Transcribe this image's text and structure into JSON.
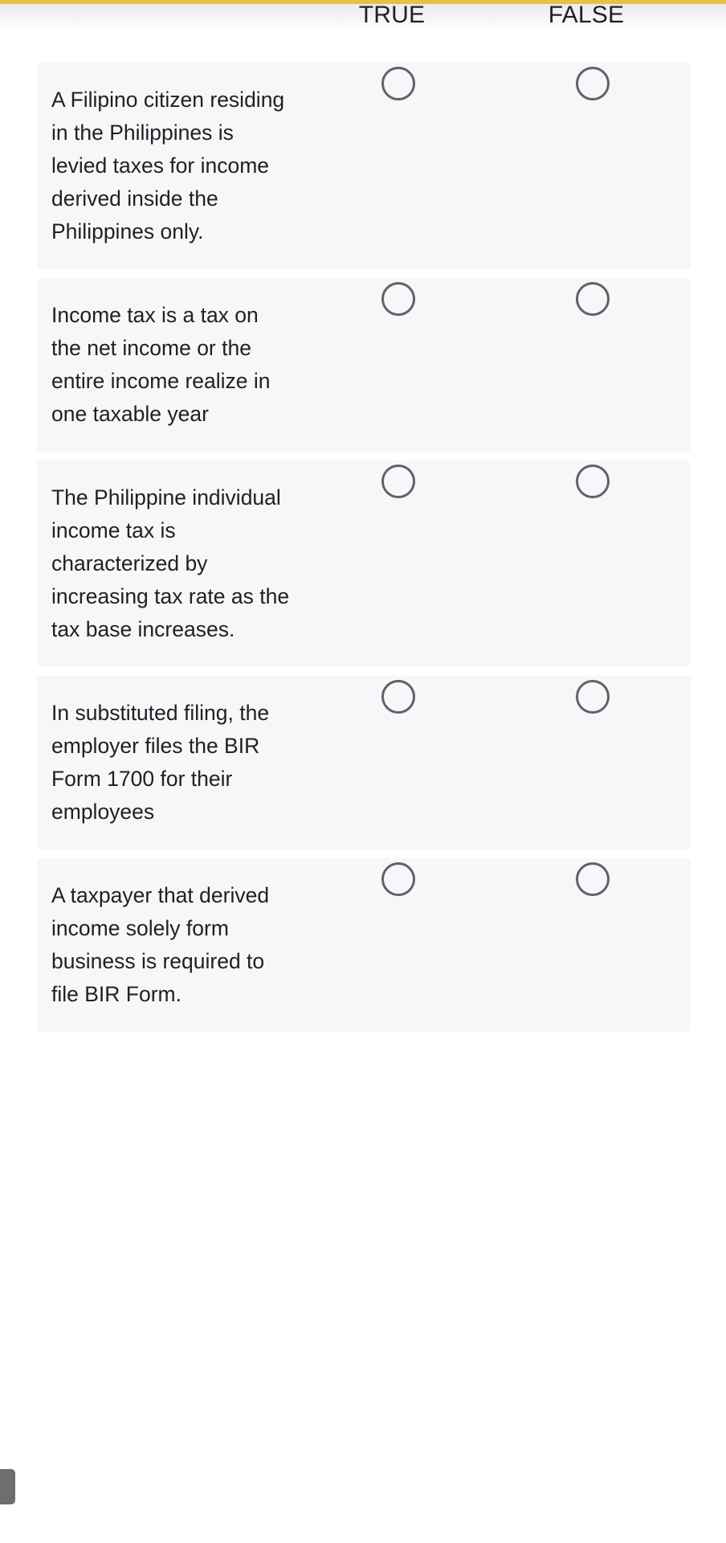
{
  "theme": {
    "accent_bar_color": "#e6c33f",
    "card_background": "#f6f7f9",
    "page_background": "#ffffff",
    "text_color": "#202124",
    "radio_border_color": "#5f6368",
    "scrollbar_color": "#6e6e6e"
  },
  "header": {
    "columns": [
      {
        "label": "TRUE"
      },
      {
        "label": "FALSE"
      }
    ]
  },
  "questions": [
    {
      "id": "q1",
      "text": "A Filipino citizen residing in the Philippines is levied taxes for income derived inside the Philippines only.",
      "options": [
        {
          "value": "TRUE",
          "selected": false
        },
        {
          "value": "FALSE",
          "selected": false
        }
      ]
    },
    {
      "id": "q2",
      "text": "Income tax is a tax on the net income or the entire income realize in one taxable year",
      "options": [
        {
          "value": "TRUE",
          "selected": false
        },
        {
          "value": "FALSE",
          "selected": false
        }
      ]
    },
    {
      "id": "q3",
      "text": "The Philippine individual income tax is characterized by increasing tax rate as the tax base increases.",
      "options": [
        {
          "value": "TRUE",
          "selected": false
        },
        {
          "value": "FALSE",
          "selected": false
        }
      ]
    },
    {
      "id": "q4",
      "text": "In substituted filing, the employer files the BIR Form 1700 for their employees",
      "options": [
        {
          "value": "TRUE",
          "selected": false
        },
        {
          "value": "FALSE",
          "selected": false
        }
      ]
    },
    {
      "id": "q5",
      "text": "A taxpayer that derived income solely form business is required to file BIR Form.",
      "options": [
        {
          "value": "TRUE",
          "selected": false
        },
        {
          "value": "FALSE",
          "selected": false
        }
      ]
    }
  ]
}
